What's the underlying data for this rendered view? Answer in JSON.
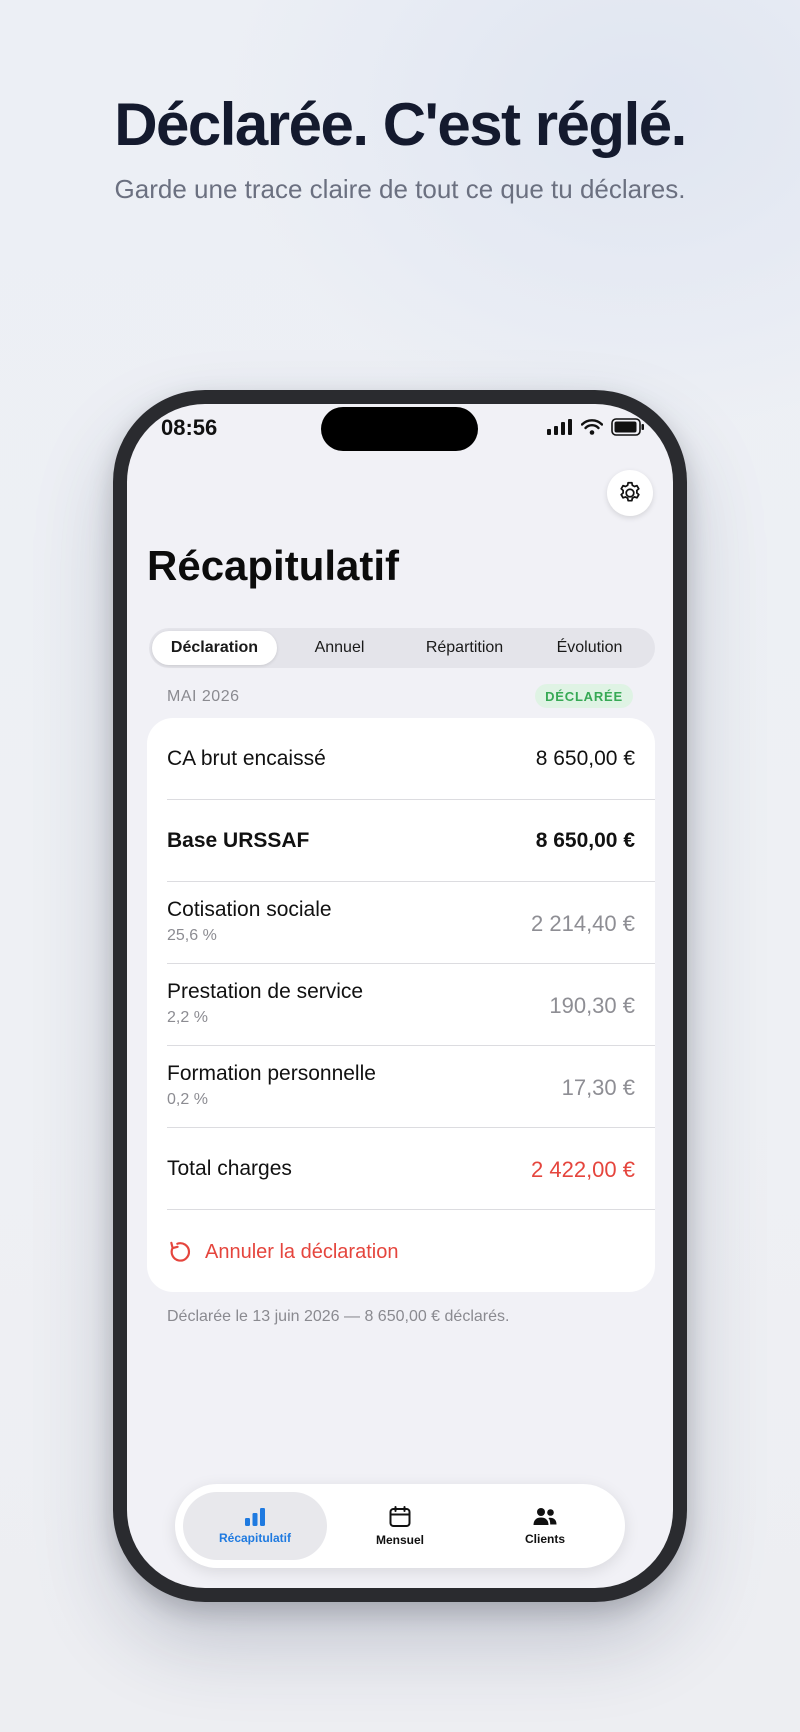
{
  "promo": {
    "headline": "Déclarée. C'est réglé.",
    "subheadline": "Garde une trace claire de tout ce que tu déclares."
  },
  "status_bar": {
    "time": "08:56"
  },
  "screen": {
    "title": "Récapitulatif",
    "settings_icon": "gear-icon",
    "segments": [
      "Déclaration",
      "Annuel",
      "Répartition",
      "Évolution"
    ],
    "selected_segment": "Déclaration",
    "period": "MAI 2026",
    "status_badge": "DÉCLARÉE",
    "rows": [
      {
        "label": "CA brut encaissé",
        "value": "8 650,00 €"
      },
      {
        "label": "Base URSSAF",
        "value": "8 650,00 €"
      },
      {
        "label": "Cotisation sociale",
        "rate": "25,6 %",
        "value": "2 214,40 €"
      },
      {
        "label": "Prestation de service",
        "rate": "2,2 %",
        "value": "190,30 €"
      },
      {
        "label": "Formation personnelle",
        "rate": "0,2 %",
        "value": "17,30 €"
      },
      {
        "label": "Total charges",
        "value": "2 422,00 €"
      }
    ],
    "cancel_action": "Annuler la déclaration",
    "footnote": "Déclarée le 13 juin 2026 — 8 650,00 € déclarés."
  },
  "tab_bar": {
    "tabs": [
      {
        "label": "Récapitulatif",
        "icon": "chart-bar-icon"
      },
      {
        "label": "Mensuel",
        "icon": "calendar-icon"
      },
      {
        "label": "Clients",
        "icon": "people-icon"
      }
    ],
    "active": "Récapitulatif"
  },
  "colors": {
    "accent_blue": "#1f7ae0",
    "danger_red": "#e5453d",
    "success_green": "#37a955"
  }
}
